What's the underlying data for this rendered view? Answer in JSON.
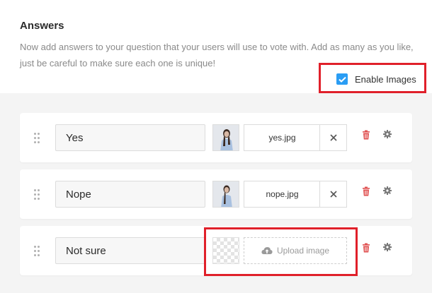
{
  "section": {
    "title": "Answers",
    "description": "Now add answers to your question that your users will use to vote with. Add as many as you like, just be careful to make sure each one is unique!"
  },
  "enable_images": {
    "label": "Enable Images",
    "checked": true
  },
  "answers": [
    {
      "text": "Yes",
      "image_file": "yes.jpg"
    },
    {
      "text": "Nope",
      "image_file": "nope.jpg"
    },
    {
      "text": "Not sure",
      "upload_label": "Upload image"
    }
  ],
  "icons": {
    "drag": "drag-handle-icon",
    "clear": "close-icon",
    "delete": "trash-icon",
    "settings": "gear-icon",
    "upload": "cloud-upload-icon"
  },
  "colors": {
    "accent": "#2a9df4",
    "highlight": "#e0202a",
    "delete": "#e05252",
    "panel": "#f4f4f4"
  }
}
